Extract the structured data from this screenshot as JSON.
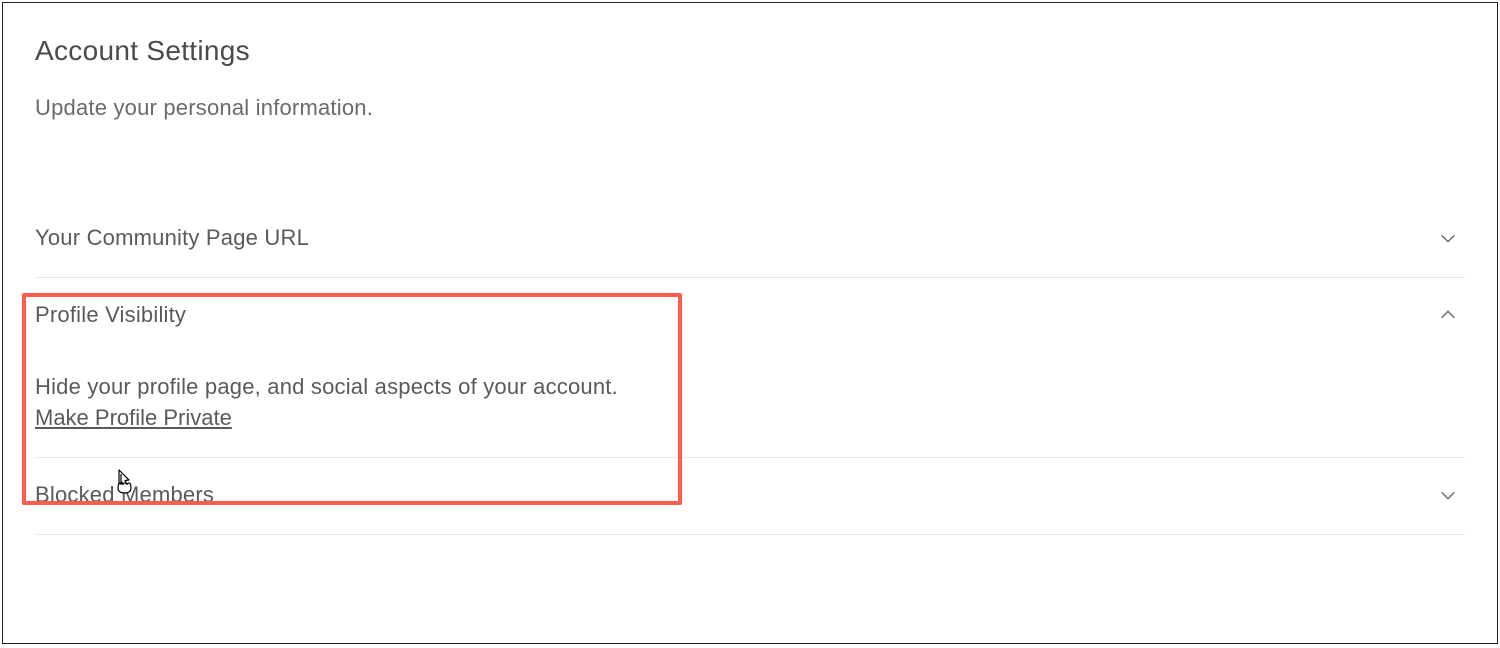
{
  "page": {
    "title": "Account Settings",
    "subtitle": "Update your personal information."
  },
  "sections": {
    "community_url": {
      "title": "Your Community Page URL"
    },
    "profile_visibility": {
      "title": "Profile Visibility",
      "body_text": "Hide your profile page, and social aspects of your account.",
      "action_label": "Make Profile Private"
    },
    "blocked_members": {
      "title": "Blocked Members"
    }
  }
}
